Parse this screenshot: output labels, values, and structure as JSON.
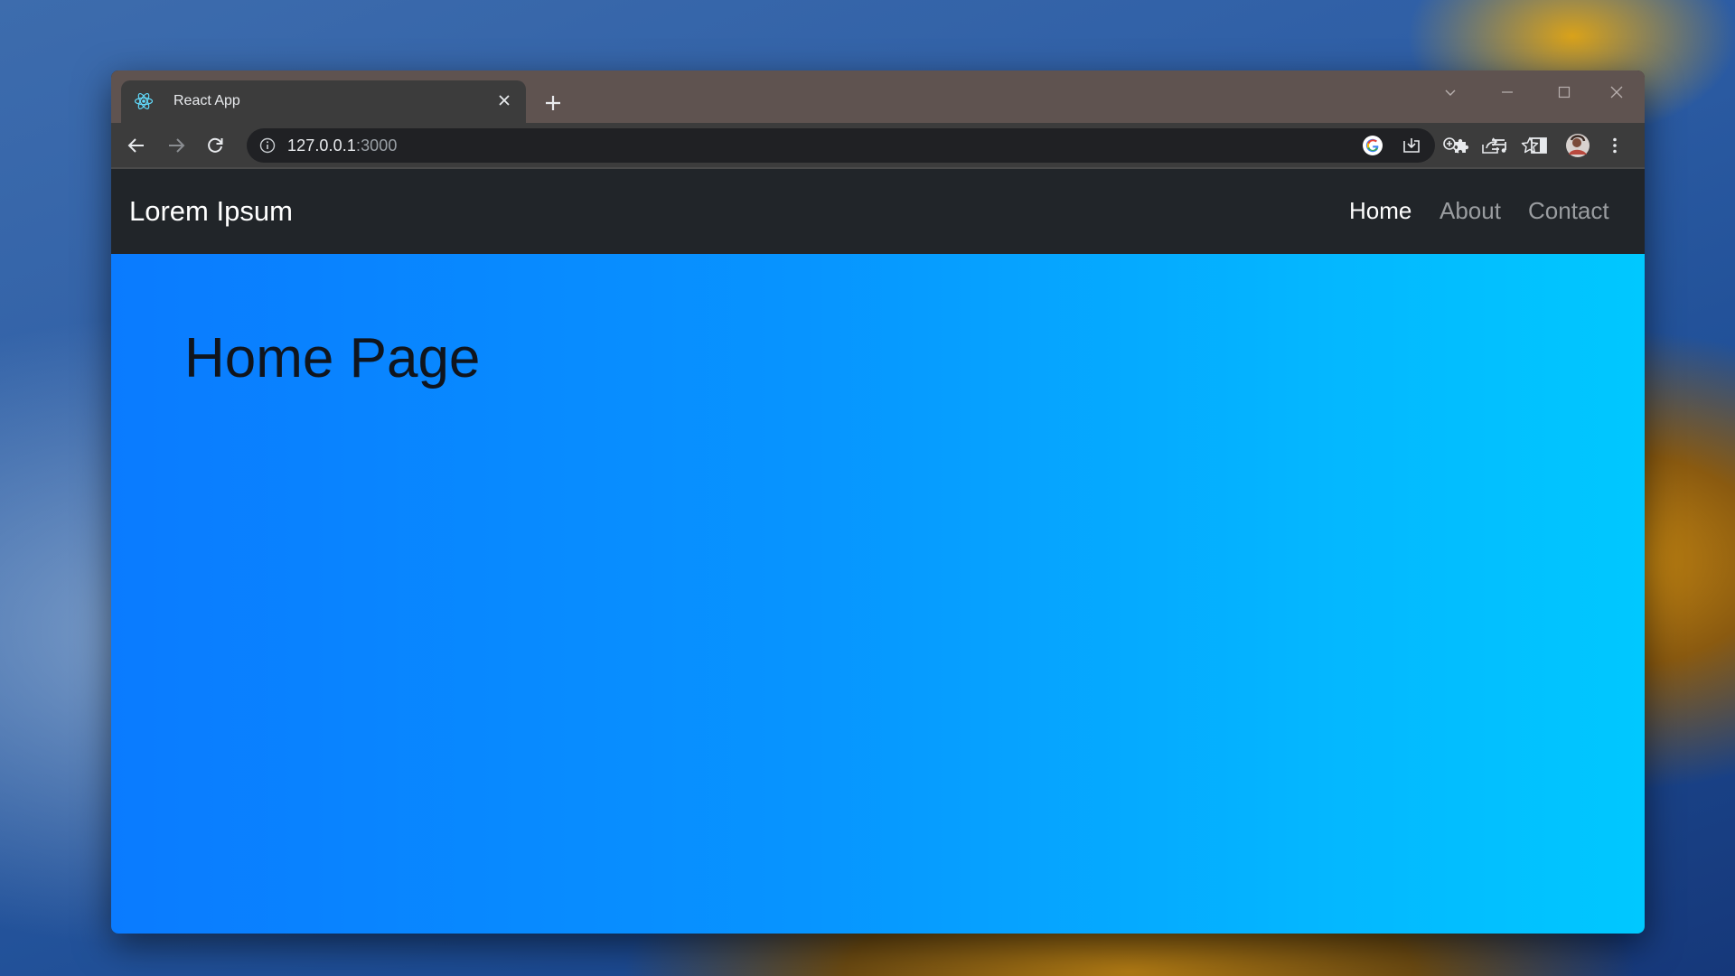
{
  "browser": {
    "tab": {
      "title": "React App",
      "favicon": "react-logo-icon"
    },
    "address_bar": {
      "host": "127.0.0.1",
      "port": ":3000"
    },
    "toolbar_icons": [
      "back-arrow-icon",
      "forward-arrow-icon",
      "reload-icon",
      "site-info-icon",
      "google-icon",
      "install-app-icon",
      "zoom-icon",
      "share-icon",
      "bookmark-star-icon",
      "extensions-puzzle-icon",
      "media-controls-icon",
      "side-panel-icon",
      "profile-avatar-icon",
      "menu-kebab-icon"
    ]
  },
  "navbar": {
    "brand": "Lorem Ipsum",
    "links": [
      {
        "label": "Home",
        "active": true
      },
      {
        "label": "About",
        "active": false
      },
      {
        "label": "Contact",
        "active": false
      }
    ]
  },
  "main": {
    "heading": "Home Page"
  },
  "colors": {
    "navbar_bg": "#212529",
    "hero_gradient_start": "#0a7bff",
    "hero_gradient_end": "#00c8ff",
    "active_link": "#ffffff",
    "inactive_link": "#9a9da0"
  }
}
